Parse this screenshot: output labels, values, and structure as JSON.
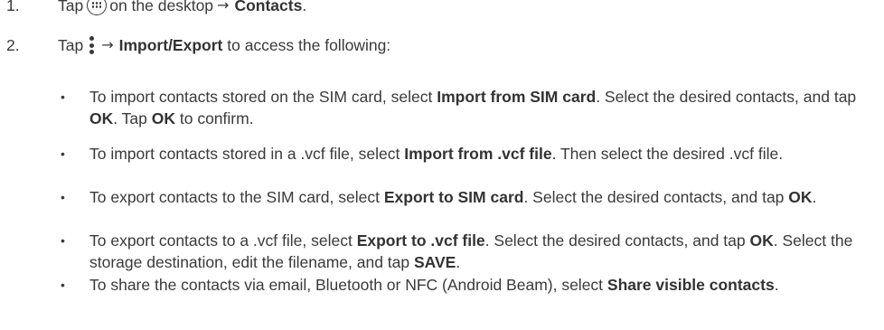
{
  "steps": [
    {
      "num": "1.",
      "t1": "Tap",
      "t2": "on the desktop",
      "t3": "Contacts",
      "t4": "."
    },
    {
      "num": "2.",
      "t1": "Tap",
      "t3": "Import/Export",
      "t4": "to access the following:"
    }
  ],
  "icons": {
    "apps": "apps-icon",
    "more": "more-vertical-icon",
    "arrow": "→"
  },
  "bullets": [
    {
      "marker": "•",
      "a": "To import contacts stored on the SIM card, select ",
      "b": "Import from SIM card",
      "c": ". Select the desired contacts, and tap ",
      "d": "OK",
      "e": ". Tap ",
      "f": "OK",
      "g": " to confirm."
    },
    {
      "marker": "•",
      "a": "To import contacts stored in a .vcf file, select ",
      "b": "Import from .vcf file",
      "c": ". Then select the desired .vcf file."
    },
    {
      "marker": "•",
      "a": "To export contacts to the SIM card, select ",
      "b": "Export to SIM card",
      "c": ". Select the desired contacts, and tap ",
      "d": "OK",
      "e": "."
    },
    {
      "marker": "•",
      "a": "To export contacts to a .vcf file, select ",
      "b": "Export to .vcf file",
      "c": ". Select the desired contacts, and tap ",
      "d": "OK",
      "e": ". Select the storage destination, edit the filename, and tap ",
      "f": "SAVE",
      "g": "."
    },
    {
      "marker": "•",
      "a": "To share the contacts via email, Bluetooth or NFC (Android Beam), select ",
      "b": "Share visible contacts",
      "c": "."
    }
  ]
}
